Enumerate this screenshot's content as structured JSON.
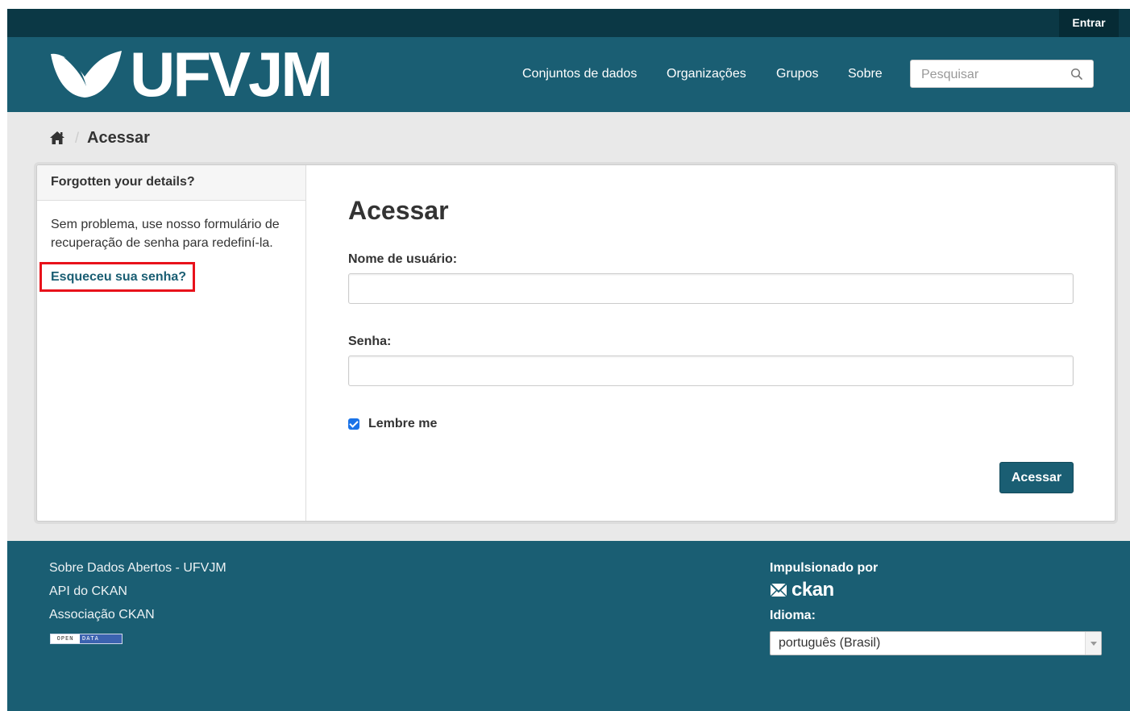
{
  "account": {
    "login_label": "Entrar"
  },
  "header": {
    "logo_text": "UFVJM",
    "nav": [
      {
        "label": "Conjuntos de dados"
      },
      {
        "label": "Organizações"
      },
      {
        "label": "Grupos"
      },
      {
        "label": "Sobre"
      }
    ],
    "search": {
      "placeholder": "Pesquisar",
      "value": "",
      "icon": "search-icon"
    }
  },
  "breadcrumb": {
    "home_icon": "home-icon",
    "current": "Acessar"
  },
  "sidebar": {
    "title": "Forgotten your details?",
    "text": "Sem problema, use nosso formulário de recuperação de senha para redefiní-la.",
    "link_label": "Esqueceu sua senha?"
  },
  "form": {
    "title": "Acessar",
    "username_label": "Nome de usuário:",
    "username_value": "",
    "password_label": "Senha:",
    "password_value": "",
    "remember_label": "Lembre me",
    "remember_checked": true,
    "submit_label": "Acessar"
  },
  "footer": {
    "links": [
      "Sobre Dados Abertos - UFVJM",
      "API do CKAN",
      "Associação CKAN"
    ],
    "open_data_badge": {
      "left": "OPEN",
      "right": "DATA"
    },
    "powered_by_label": "Impulsionado por",
    "ckan_logo_text": "ckan",
    "language_label": "Idioma:",
    "language_value": "português (Brasil)"
  },
  "colors": {
    "header_bg": "#1a5e73",
    "account_bar_bg": "#0b3845",
    "link": "#1a5e73",
    "highlight_border": "#e8121b",
    "checkbox": "#1a73e8"
  }
}
